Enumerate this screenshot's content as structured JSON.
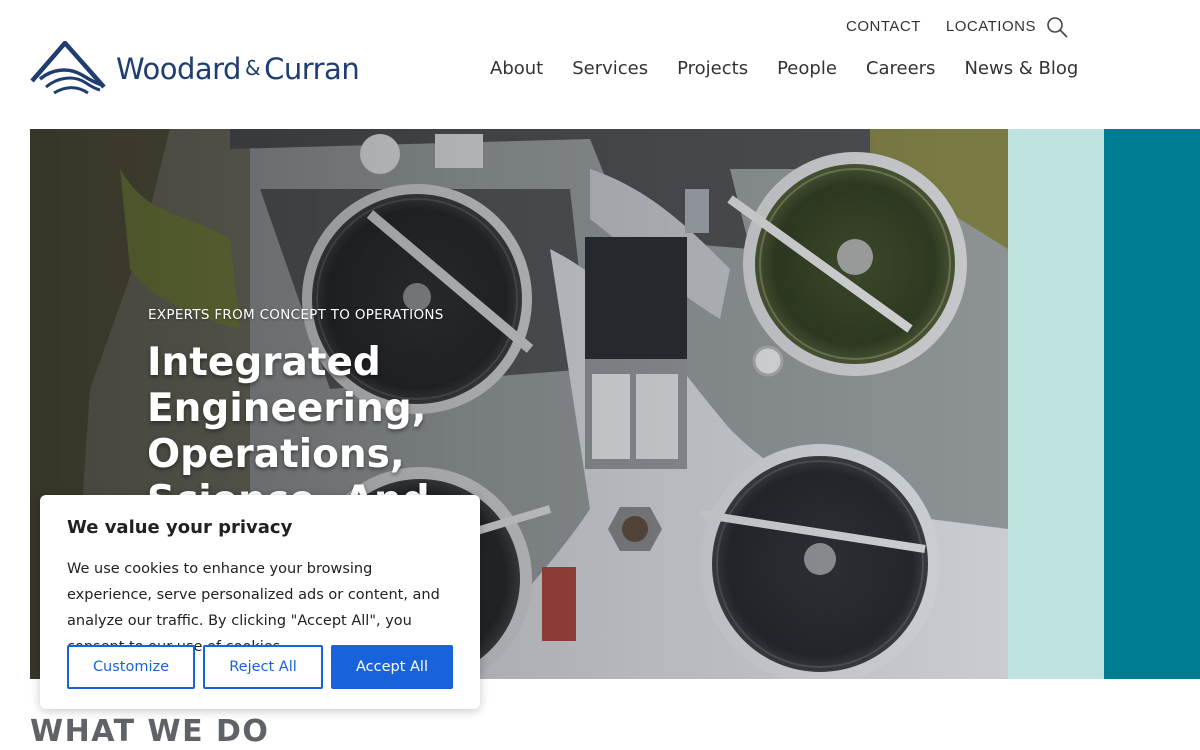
{
  "header": {
    "logo_text": "Woodard",
    "logo_amp": "&",
    "logo_text2": "Curran",
    "utility_links": [
      "CONTACT",
      "LOCATIONS"
    ],
    "nav": [
      "About",
      "Services",
      "Projects",
      "People",
      "Careers",
      "News & Blog"
    ]
  },
  "hero": {
    "eyebrow": "EXPERTS FROM CONCEPT TO OPERATIONS",
    "title": "Integrated Engineering, Operations, Science, And Construction"
  },
  "section": {
    "heading": "WHAT WE DO"
  },
  "cookie": {
    "title": "We value your privacy",
    "text": "We use cookies to enhance your browsing experience, serve personalized ads or content, and analyze our traffic. By clicking \"Accept All\", you consent to our use of cookies.",
    "customize_label": "Customize",
    "reject_label": "Reject All",
    "accept_label": "Accept All"
  },
  "colors": {
    "brand_navy": "#1f3d70",
    "accent_teal": "#007b94",
    "accent_mint": "#bfe3de",
    "cookie_blue": "#1863dc"
  },
  "icons": {
    "search": "search-icon",
    "logo": "woodard-curran-logo-icon"
  }
}
